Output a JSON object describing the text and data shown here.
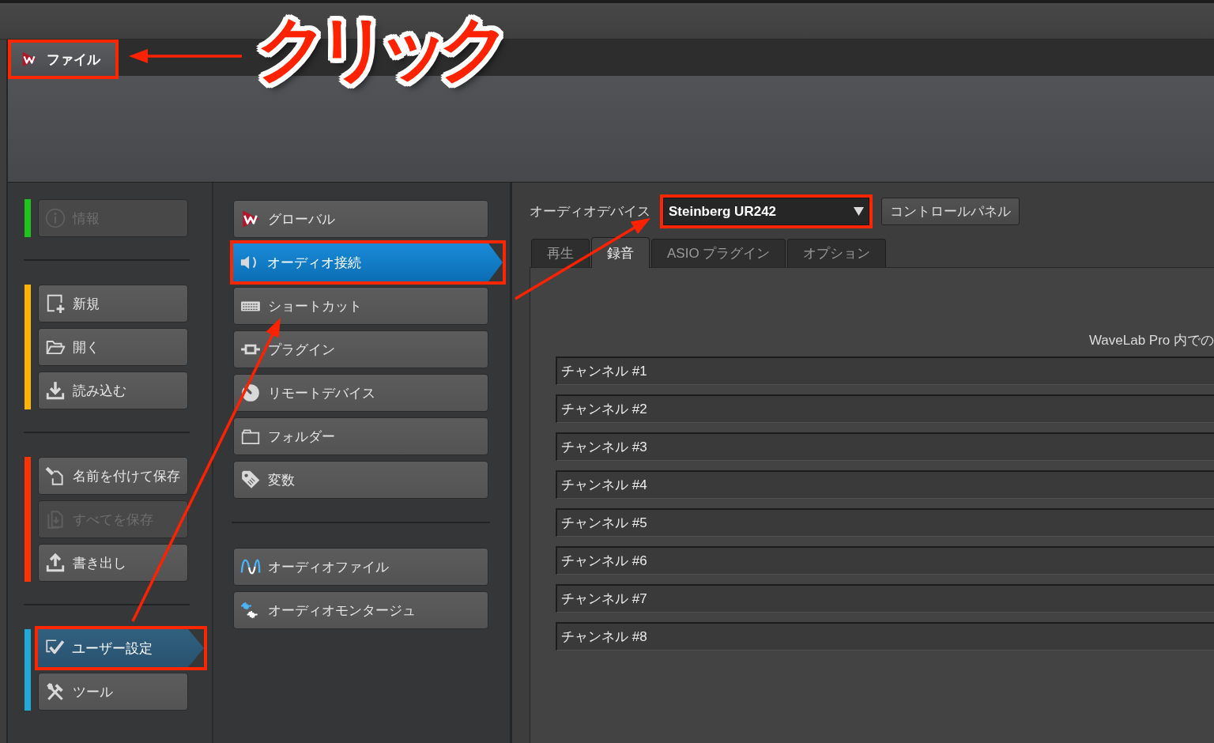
{
  "menu_bar": {
    "file_button": {
      "label": "ファイル",
      "highlighted": true
    }
  },
  "annotation": {
    "label": "クリック"
  },
  "sidebar": {
    "groups": [
      {
        "color": "#1ec31e",
        "items": [
          {
            "label": "情報",
            "disabled": true,
            "selected": false,
            "highlighted": false
          }
        ]
      },
      {
        "color": "#ffb400",
        "items": [
          {
            "label": "新規",
            "disabled": false,
            "selected": false,
            "highlighted": false
          },
          {
            "label": "開く",
            "disabled": false,
            "selected": false,
            "highlighted": false
          },
          {
            "label": "読み込む",
            "disabled": false,
            "selected": false,
            "highlighted": false
          }
        ]
      },
      {
        "color": "#ff3300",
        "items": [
          {
            "label": "名前を付けて保存",
            "disabled": false,
            "selected": false,
            "highlighted": false
          },
          {
            "label": "すべてを保存",
            "disabled": true,
            "selected": false,
            "highlighted": false
          },
          {
            "label": "書き出し",
            "disabled": false,
            "selected": false,
            "highlighted": false
          }
        ]
      },
      {
        "color": "#1ea9d9",
        "items": [
          {
            "label": "ユーザー設定",
            "disabled": false,
            "selected": true,
            "highlighted": true
          },
          {
            "label": "ツール",
            "disabled": false,
            "selected": false,
            "highlighted": false
          }
        ]
      }
    ]
  },
  "settings_categories": {
    "groups": [
      {
        "items": [
          {
            "label": "グローバル",
            "selected": false,
            "highlighted": false
          },
          {
            "label": "オーディオ接続",
            "selected": true,
            "highlighted": true
          },
          {
            "label": "ショートカット",
            "selected": false,
            "highlighted": false
          },
          {
            "label": "プラグイン",
            "selected": false,
            "highlighted": false
          },
          {
            "label": "リモートデバイス",
            "selected": false,
            "highlighted": false
          },
          {
            "label": "フォルダー",
            "selected": false,
            "highlighted": false
          },
          {
            "label": "変数",
            "selected": false,
            "highlighted": false
          }
        ]
      },
      {
        "items": [
          {
            "label": "オーディオファイル",
            "selected": false,
            "highlighted": false
          },
          {
            "label": "オーディオモンタージュ",
            "selected": false,
            "highlighted": false
          }
        ]
      }
    ]
  },
  "audio_device": {
    "label": "オーディオデバイス",
    "dropdown": {
      "value": "Steinberg UR242",
      "highlighted": true
    },
    "button": "コントロールパネル"
  },
  "tabs": [
    {
      "label": "再生",
      "selected": false
    },
    {
      "label": "録音",
      "selected": true
    },
    {
      "label": "ASIO プラグイン",
      "selected": false
    },
    {
      "label": "オプション",
      "selected": false
    }
  ],
  "tab_panel": {
    "caption": "WaveLab Pro 内での",
    "channels": [
      {
        "label": "チャンネル #1"
      },
      {
        "label": "チャンネル #2"
      },
      {
        "label": "チャンネル #3"
      },
      {
        "label": "チャンネル #4"
      },
      {
        "label": "チャンネル #5"
      },
      {
        "label": "チャンネル #6"
      },
      {
        "label": "チャンネル #7"
      },
      {
        "label": "チャンネル #8"
      }
    ]
  }
}
